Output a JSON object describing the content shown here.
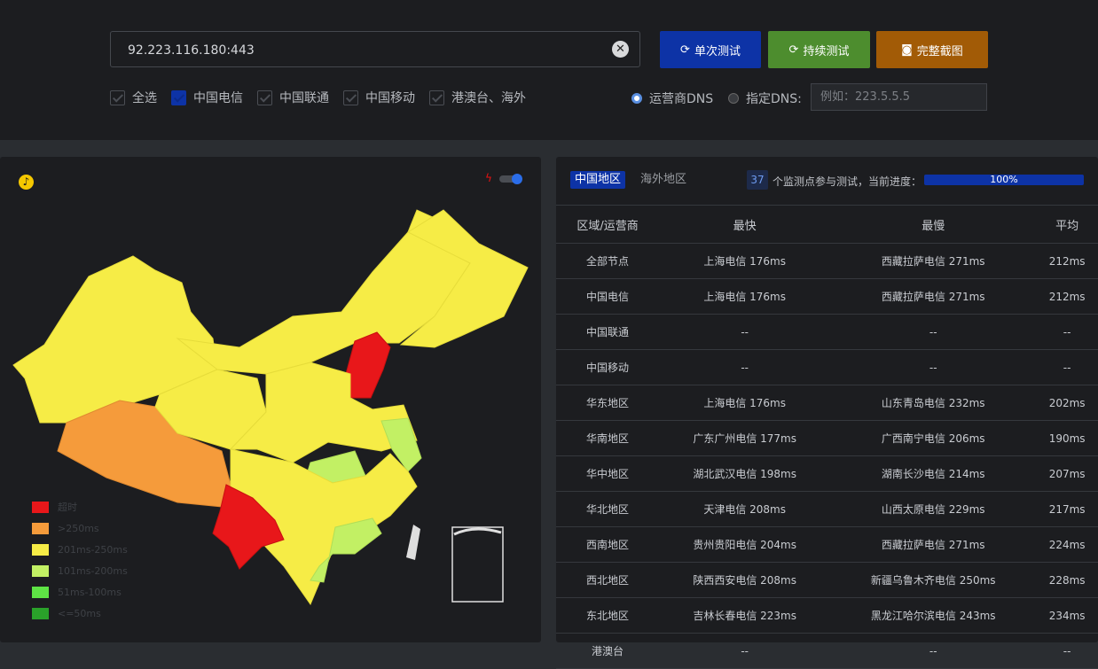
{
  "address": {
    "value": "92.223.116.180:443"
  },
  "buttons": {
    "single": "单次测试",
    "continuous": "持续测试",
    "screenshot": "完整截图"
  },
  "filters": [
    {
      "label": "全选",
      "checked": false
    },
    {
      "label": "中国电信",
      "checked": true
    },
    {
      "label": "中国联通",
      "checked": false
    },
    {
      "label": "中国移动",
      "checked": false
    },
    {
      "label": "港澳台、海外",
      "checked": false
    }
  ],
  "dns": {
    "isp_label": "运营商DNS",
    "custom_label": "指定DNS:",
    "placeholder": "例如：223.5.5.5"
  },
  "tabs": {
    "china": "中国地区",
    "overseas": "海外地区"
  },
  "progress": {
    "count": "37",
    "label": "个监测点参与测试，当前进度：",
    "percent": "100%"
  },
  "table": {
    "headers": [
      "区域/运营商",
      "最快",
      "最慢",
      "平均"
    ],
    "rows": [
      [
        "全部节点",
        "上海电信 176ms",
        "西藏拉萨电信 271ms",
        "212ms"
      ],
      [
        "中国电信",
        "上海电信 176ms",
        "西藏拉萨电信 271ms",
        "212ms"
      ],
      [
        "中国联通",
        "--",
        "--",
        "--"
      ],
      [
        "中国移动",
        "--",
        "--",
        "--"
      ],
      [
        "华东地区",
        "上海电信 176ms",
        "山东青岛电信 232ms",
        "202ms"
      ],
      [
        "华南地区",
        "广东广州电信 177ms",
        "广西南宁电信 206ms",
        "190ms"
      ],
      [
        "华中地区",
        "湖北武汉电信 198ms",
        "湖南长沙电信 214ms",
        "207ms"
      ],
      [
        "华北地区",
        "天津电信 208ms",
        "山西太原电信 229ms",
        "217ms"
      ],
      [
        "西南地区",
        "贵州贵阳电信 204ms",
        "西藏拉萨电信 271ms",
        "224ms"
      ],
      [
        "西北地区",
        "陕西西安电信 208ms",
        "新疆乌鲁木齐电信 250ms",
        "228ms"
      ],
      [
        "东北地区",
        "吉林长春电信 223ms",
        "黑龙江哈尔滨电信 243ms",
        "234ms"
      ],
      [
        "港澳台",
        "--",
        "--",
        "--"
      ]
    ]
  },
  "legend": [
    {
      "label": "超时",
      "color": "#e8171a"
    },
    {
      "label": ">250ms",
      "color": "#f59b3b"
    },
    {
      "label": "201ms-250ms",
      "color": "#f6ec46"
    },
    {
      "label": "101ms-200ms",
      "color": "#c2f064"
    },
    {
      "label": "51ms-100ms",
      "color": "#5ee345"
    },
    {
      "label": "<=50ms",
      "color": "#2aa22a"
    }
  ]
}
